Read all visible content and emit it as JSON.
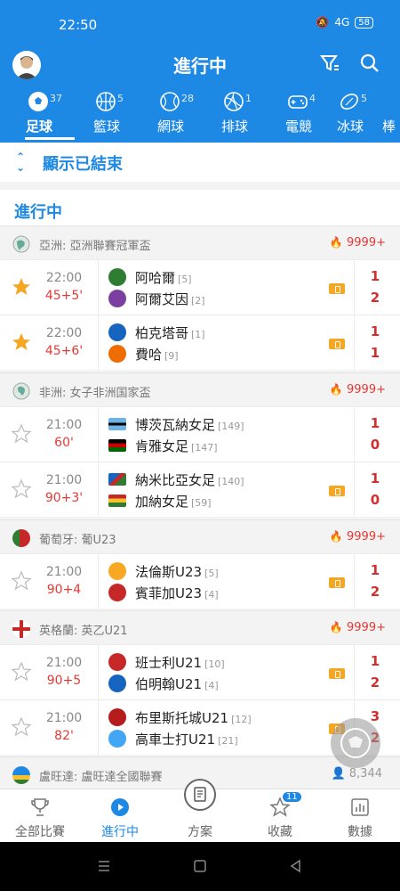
{
  "status": {
    "time": "22:50",
    "battery": "58",
    "signal": "4G"
  },
  "header": {
    "title": "進行中"
  },
  "tabs": [
    {
      "label": "足球",
      "count": "37",
      "icon": "soccer-ball-icon"
    },
    {
      "label": "籃球",
      "count": "5",
      "icon": "basketball-icon"
    },
    {
      "label": "網球",
      "count": "28",
      "icon": "tennis-ball-icon"
    },
    {
      "label": "排球",
      "count": "1",
      "icon": "volleyball-icon"
    },
    {
      "label": "電競",
      "count": "4",
      "icon": "gamepad-icon"
    },
    {
      "label": "冰球",
      "count": "5",
      "icon": "hockey-puck-icon"
    },
    {
      "label": "棒",
      "count": "",
      "icon": "baseball-icon"
    }
  ],
  "toggle": {
    "label": "顯示已結束"
  },
  "section": {
    "title": "進行中"
  },
  "leagues": [
    {
      "name": "亞洲: 亞洲聯賽冠軍盃",
      "hot": "9999+",
      "matches": [
        {
          "time": "22:00",
          "minute": "45+5'",
          "fav": true,
          "home": "阿哈爾",
          "home_rank": "[5]",
          "away": "阿爾艾因",
          "away_rank": "[2]",
          "home_score": "1",
          "away_score": "2",
          "live": true
        },
        {
          "time": "22:00",
          "minute": "45+6'",
          "fav": true,
          "home": "柏克塔哥",
          "home_rank": "[1]",
          "away": "費哈",
          "away_rank": "[9]",
          "home_score": "1",
          "away_score": "1",
          "live": true
        }
      ]
    },
    {
      "name": "非洲: 女子非洲国家盃",
      "hot": "9999+",
      "matches": [
        {
          "time": "21:00",
          "minute": "60'",
          "fav": false,
          "home": "博茨瓦納女足",
          "home_rank": "[149]",
          "away": "肯雅女足",
          "away_rank": "[147]",
          "home_score": "1",
          "away_score": "0",
          "live": false
        },
        {
          "time": "21:00",
          "minute": "90+3'",
          "fav": false,
          "home": "納米比亞女足",
          "home_rank": "[140]",
          "away": "加納女足",
          "away_rank": "[59]",
          "home_score": "1",
          "away_score": "0",
          "live": true
        }
      ]
    },
    {
      "name": "葡萄牙: 葡U23",
      "hot": "9999+",
      "matches": [
        {
          "time": "21:00",
          "minute": "90+4",
          "fav": false,
          "home": "法倫斯U23",
          "home_rank": "[5]",
          "away": "賓菲加U23",
          "away_rank": "[4]",
          "home_score": "1",
          "away_score": "2",
          "live": true
        }
      ]
    },
    {
      "name": "英格蘭: 英乙U21",
      "hot": "9999+",
      "matches": [
        {
          "time": "21:00",
          "minute": "90+5",
          "fav": false,
          "home": "班士利U21",
          "home_rank": "[10]",
          "away": "伯明翰U21",
          "away_rank": "[4]",
          "home_score": "1",
          "away_score": "2",
          "live": true
        },
        {
          "time": "21:00",
          "minute": "82'",
          "fav": false,
          "home": "布里斯托城U21",
          "home_rank": "[12]",
          "away": "高車士打U21",
          "away_rank": "[21]",
          "home_score": "3",
          "away_score": "2",
          "live": true
        }
      ]
    },
    {
      "name": "盧旺達: 盧旺達全國聯賽",
      "views": "8,344",
      "matches": []
    }
  ],
  "bottom_nav": [
    {
      "label": "全部比賽",
      "icon": "trophy-icon"
    },
    {
      "label": "進行中",
      "icon": "play-circle-icon"
    },
    {
      "label": "方案",
      "icon": "document-icon"
    },
    {
      "label": "收藏",
      "icon": "star-outline-icon",
      "badge": "11"
    },
    {
      "label": "數據",
      "icon": "bar-chart-icon"
    }
  ],
  "colors": {
    "primary": "#1e88e5",
    "score": "#d32f2f",
    "hot": "#e53935",
    "live_badge": "#f5a623"
  }
}
